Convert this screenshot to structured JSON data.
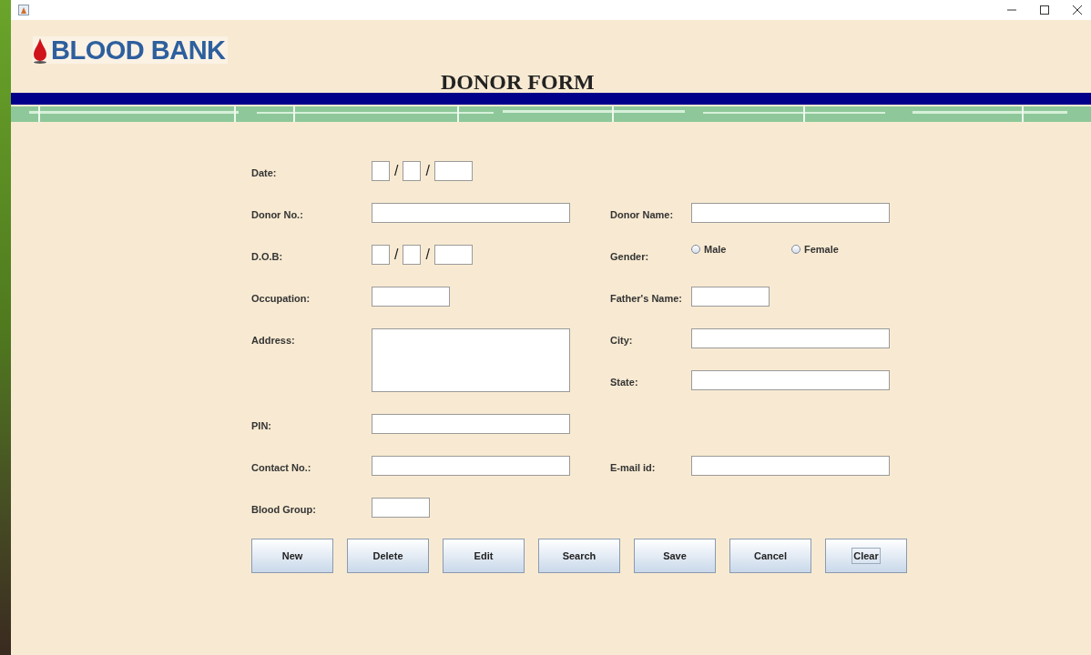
{
  "header": {
    "logo_text": "BLOOD BANK",
    "title": "DONOR FORM"
  },
  "rows": [
    {
      "cells": [
        {
          "kind": "date",
          "label": "Date:",
          "separators": [
            "/",
            "/"
          ]
        }
      ]
    },
    {
      "cells": [
        {
          "kind": "text",
          "label": "Donor No.:"
        },
        {
          "kind": "text",
          "label": "Donor Name:"
        }
      ]
    },
    {
      "cells": [
        {
          "kind": "date",
          "label": "D.O.B:",
          "separators": [
            "/",
            "/"
          ]
        },
        {
          "kind": "radio",
          "label": "Gender:",
          "options": [
            {
              "label": "Male",
              "selected": false
            },
            {
              "label": "Female",
              "selected": false
            }
          ]
        }
      ]
    },
    {
      "cells": [
        {
          "kind": "short",
          "label": "Occupation:"
        },
        {
          "kind": "short",
          "label": "Father's Name:"
        }
      ]
    },
    {
      "cells": [
        {
          "kind": "textarea",
          "label": "Address:"
        },
        {
          "kind": "stack",
          "fields": [
            {
              "kind": "text",
              "label": "City:"
            },
            {
              "kind": "text",
              "label": "State:"
            }
          ]
        }
      ]
    },
    {
      "cells": [
        {
          "kind": "text",
          "label": "PIN:"
        }
      ]
    },
    {
      "cells": [
        {
          "kind": "text",
          "label": "Contact No.:"
        },
        {
          "kind": "text",
          "label": "E-mail id:"
        }
      ]
    },
    {
      "cells": [
        {
          "kind": "tiny",
          "label": "Blood Group:"
        }
      ]
    }
  ],
  "buttons": [
    {
      "label": "New",
      "focused": false
    },
    {
      "label": "Delete",
      "focused": false
    },
    {
      "label": "Edit",
      "focused": false
    },
    {
      "label": "Search",
      "focused": false
    },
    {
      "label": "Save",
      "focused": false
    },
    {
      "label": "Cancel",
      "focused": false
    },
    {
      "label": "Clear",
      "focused": true
    }
  ]
}
